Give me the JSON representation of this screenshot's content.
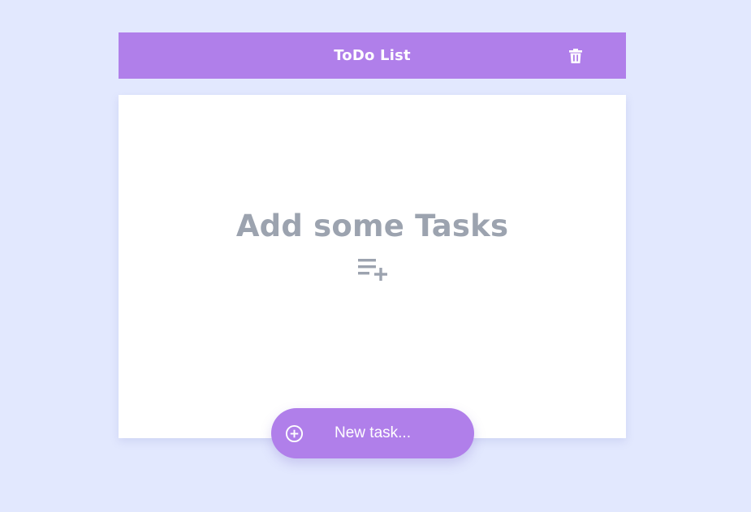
{
  "header": {
    "title": "ToDo List",
    "trash_icon": "trash-icon"
  },
  "empty_state": {
    "message": "Add some Tasks",
    "icon": "playlist-add-icon"
  },
  "new_task_button": {
    "label": "New task...",
    "icon": "add-circle-icon"
  },
  "colors": {
    "background": "#e2e8fe",
    "accent": "#b07fea",
    "panel": "#ffffff",
    "muted_text": "#9ca3af"
  }
}
